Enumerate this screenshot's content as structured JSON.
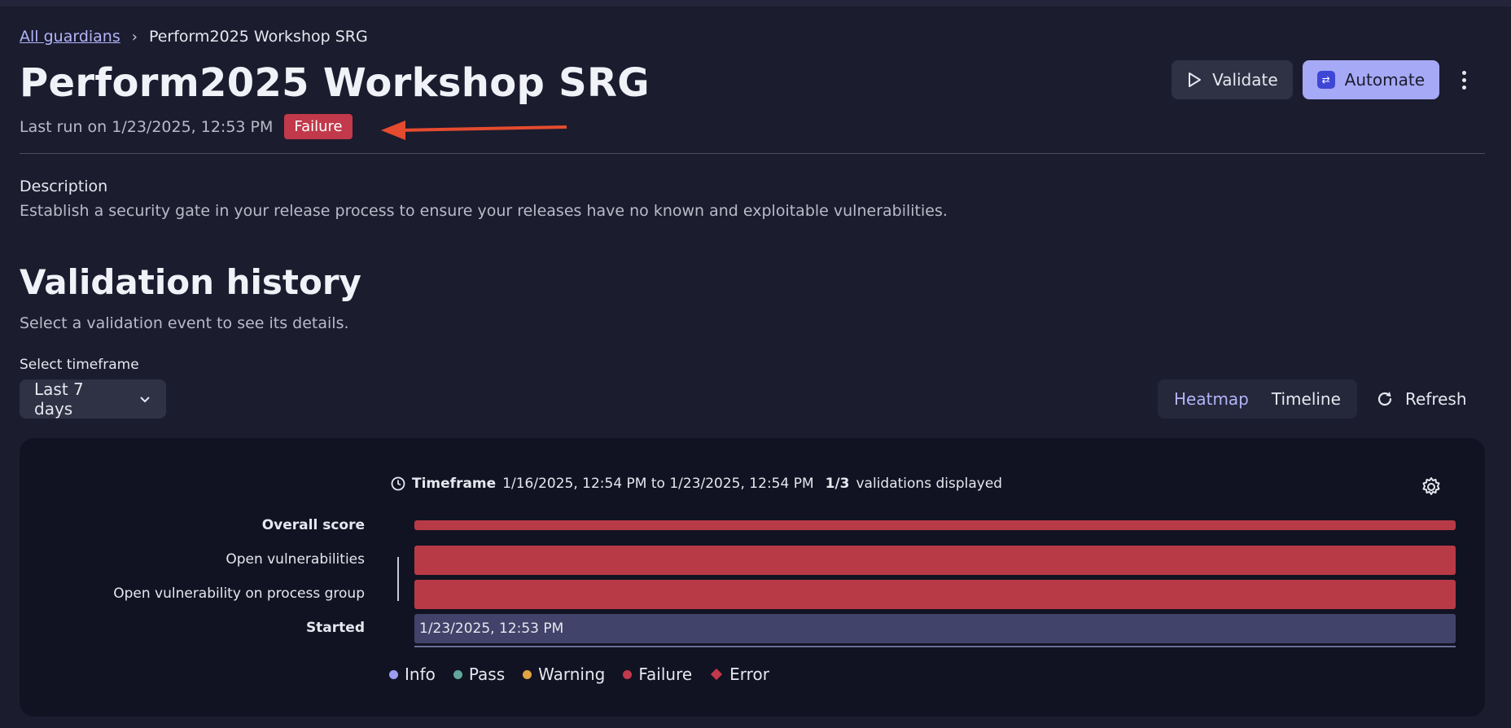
{
  "breadcrumb": {
    "parent": "All guardians",
    "current": "Perform2025 Workshop SRG"
  },
  "header": {
    "title": "Perform2025 Workshop SRG",
    "last_run": "Last run on 1/23/2025, 12:53 PM",
    "status": "Failure",
    "status_color": "#c1394a"
  },
  "actions": {
    "validate": "Validate",
    "automate": "Automate",
    "more_icon": "kebab-menu-icon"
  },
  "description": {
    "label": "Description",
    "text": "Establish a security gate in your release process to ensure your releases have no known and exploitable vulnerabilities."
  },
  "history": {
    "title": "Validation history",
    "subtitle": "Select a validation event to see its details.",
    "timeframe_label": "Select timeframe",
    "timeframe_value": "Last 7 days",
    "views": [
      "Heatmap",
      "Timeline"
    ],
    "active_view": "Heatmap",
    "refresh": "Refresh"
  },
  "heatmap": {
    "timeframe_label": "Timeframe",
    "timeframe_range": "1/16/2025, 12:54 PM to 1/23/2025, 12:54 PM",
    "count": "1/3",
    "count_suffix": "validations displayed",
    "rows": [
      {
        "label": "Overall score",
        "status": "Failure"
      },
      {
        "label": "Open vulnerabilities",
        "status": "Failure"
      },
      {
        "label": "Open vulnerability on process group",
        "status": "Failure"
      },
      {
        "label": "Started",
        "value": "1/23/2025, 12:53 PM"
      }
    ],
    "legend": [
      {
        "label": "Info",
        "color": "#9b9ef0",
        "shape": "circle"
      },
      {
        "label": "Pass",
        "color": "#5fa89a",
        "shape": "circle"
      },
      {
        "label": "Warning",
        "color": "#e0a542",
        "shape": "circle"
      },
      {
        "label": "Failure",
        "color": "#c1394a",
        "shape": "circle"
      },
      {
        "label": "Error",
        "color": "#c1394a",
        "shape": "diamond"
      }
    ]
  }
}
